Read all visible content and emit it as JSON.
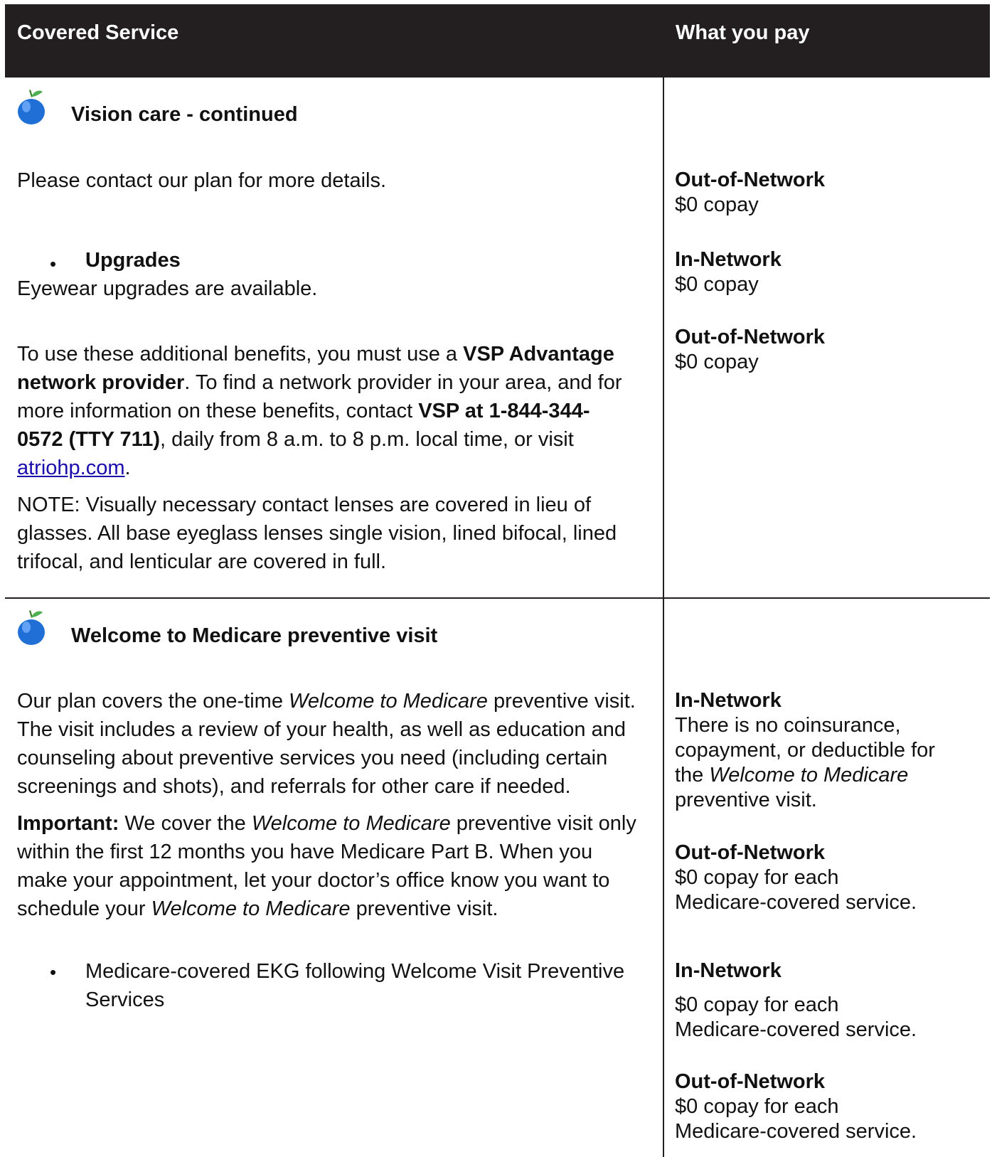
{
  "header": {
    "col1": "Covered Service",
    "col2": "What you pay"
  },
  "colors": {
    "header_bg": "#231f20",
    "header_text": "#ffffff",
    "link": "#1a0dab",
    "apple": "#1f6fd6"
  },
  "vision": {
    "icon": "apple-icon",
    "title": "Vision care - continued",
    "contact": "Please contact our plan for more details.",
    "upgrades_label": "Upgrades",
    "upgrades_text": "Eyewear upgrades are available.",
    "p1": {
      "a": "To use these additional benefits, you must use a ",
      "b": "VSP Advantage",
      "c": "network provider",
      "d": ". To find a network provider in your area, and for",
      "e": "more information on these benefits, contact ",
      "f": "VSP at 1-844-344-",
      "g": "0572 (TTY 711)",
      "h": ", daily from 8 a.m. to 8 p.m. local time, or visit",
      "link": "atriohp.com",
      "end": "."
    },
    "note": [
      "NOTE:  Visually necessary contact lenses are covered in lieu of",
      "glasses. All base eyeglass lenses single vision, lined bifocal, lined",
      "trifocal, and lenticular are covered in full."
    ],
    "pay": [
      {
        "label": "Out-of-Network",
        "value": "$0 copay"
      },
      {
        "label": "In-Network",
        "value": "$0 copay"
      },
      {
        "label": "Out-of-Network",
        "value": "$0 copay"
      }
    ]
  },
  "welcome": {
    "icon": "apple-icon",
    "title": "Welcome to Medicare preventive visit",
    "p1": {
      "l1a": "Our plan covers the one-time ",
      "l1b": "Welcome to Medicare",
      "l1c": " preventive visit.",
      "l2": "The visit includes a review of your health, as well as education and",
      "l3": "counseling about preventive services you need (including certain",
      "l4": "screenings and shots), and referrals for other care if needed."
    },
    "p2": {
      "l1a": "Important:",
      "l1b": " We cover the ",
      "l1c": "Welcome to Medicare",
      "l1d": " preventive visit only",
      "l2": "within the first 12 months you have Medicare Part B. When you",
      "l3": "make your appointment, let your doctor’s office know you want to",
      "l4a": "schedule your ",
      "l4b": "Welcome to Medicare",
      "l4c": " preventive visit."
    },
    "ekg": [
      "Medicare-covered EKG following Welcome Visit Preventive",
      "Services"
    ],
    "pay": {
      "in1_label": "In-Network",
      "in1_l1": "There is no coinsurance,",
      "in1_l2": "copayment, or deductible for",
      "in1_l3a": "the ",
      "in1_l3b": "Welcome to Medicare",
      "in1_l4": "preventive visit.",
      "out1_label": "Out-of-Network",
      "out1_l1": "$0 copay for each",
      "out1_l2": "Medicare-covered service.",
      "in2_label": "In-Network",
      "in2_l1": "$0 copay for each",
      "in2_l2": "Medicare-covered service.",
      "out2_label": "Out-of-Network",
      "out2_l1": "$0 copay for each",
      "out2_l2": "Medicare-covered service."
    }
  }
}
